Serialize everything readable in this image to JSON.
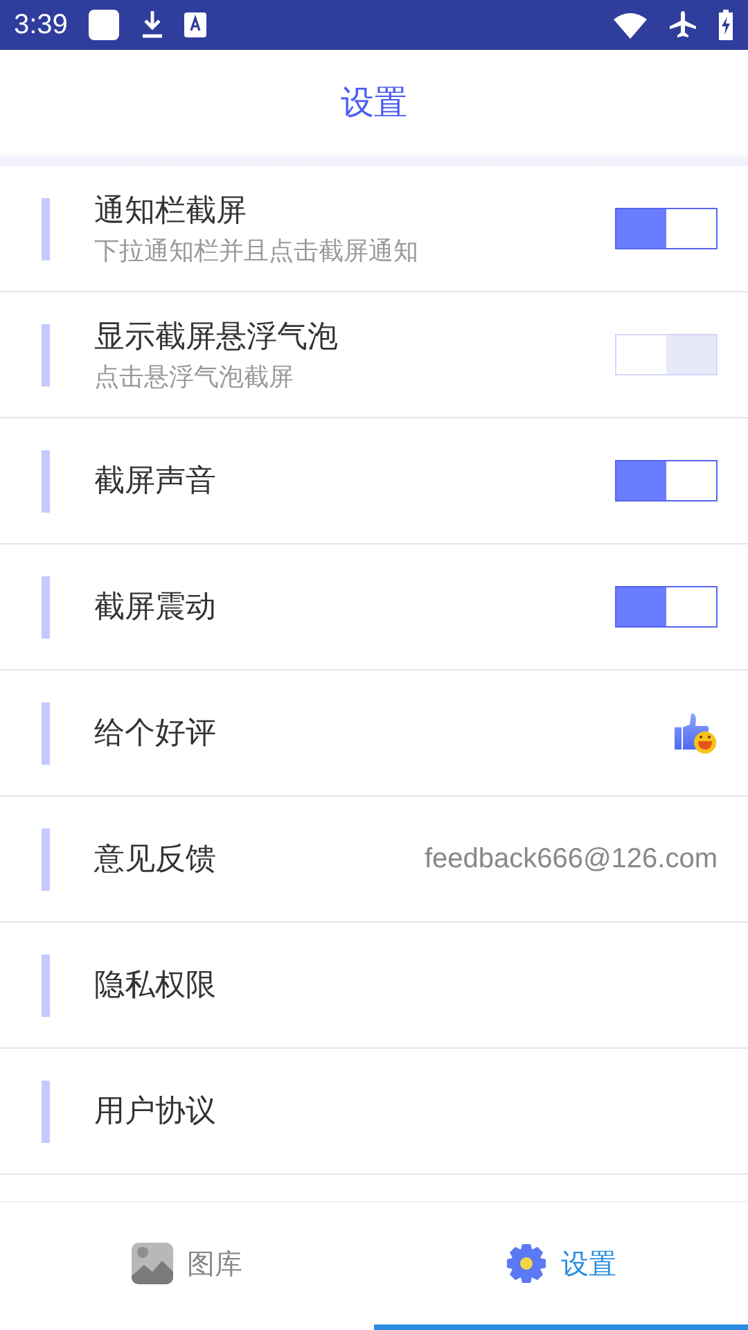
{
  "status_bar": {
    "time": "3:39"
  },
  "header": {
    "title": "设置"
  },
  "settings": [
    {
      "kind": "toggle",
      "title": "通知栏截屏",
      "subtitle": "下拉通知栏并且点击截屏通知",
      "on": true
    },
    {
      "kind": "toggle",
      "title": "显示截屏悬浮气泡",
      "subtitle": "点击悬浮气泡截屏",
      "on": false
    },
    {
      "kind": "toggle",
      "title": "截屏声音",
      "on": true
    },
    {
      "kind": "toggle",
      "title": "截屏震动",
      "on": true
    },
    {
      "kind": "icon",
      "title": "给个好评"
    },
    {
      "kind": "value",
      "title": "意见反馈",
      "value": "feedback666@126.com"
    },
    {
      "kind": "plain",
      "title": "隐私权限"
    },
    {
      "kind": "plain",
      "title": "用户协议"
    }
  ],
  "tabs": [
    {
      "label": "图库",
      "selected": false
    },
    {
      "label": "设置",
      "selected": true
    }
  ]
}
